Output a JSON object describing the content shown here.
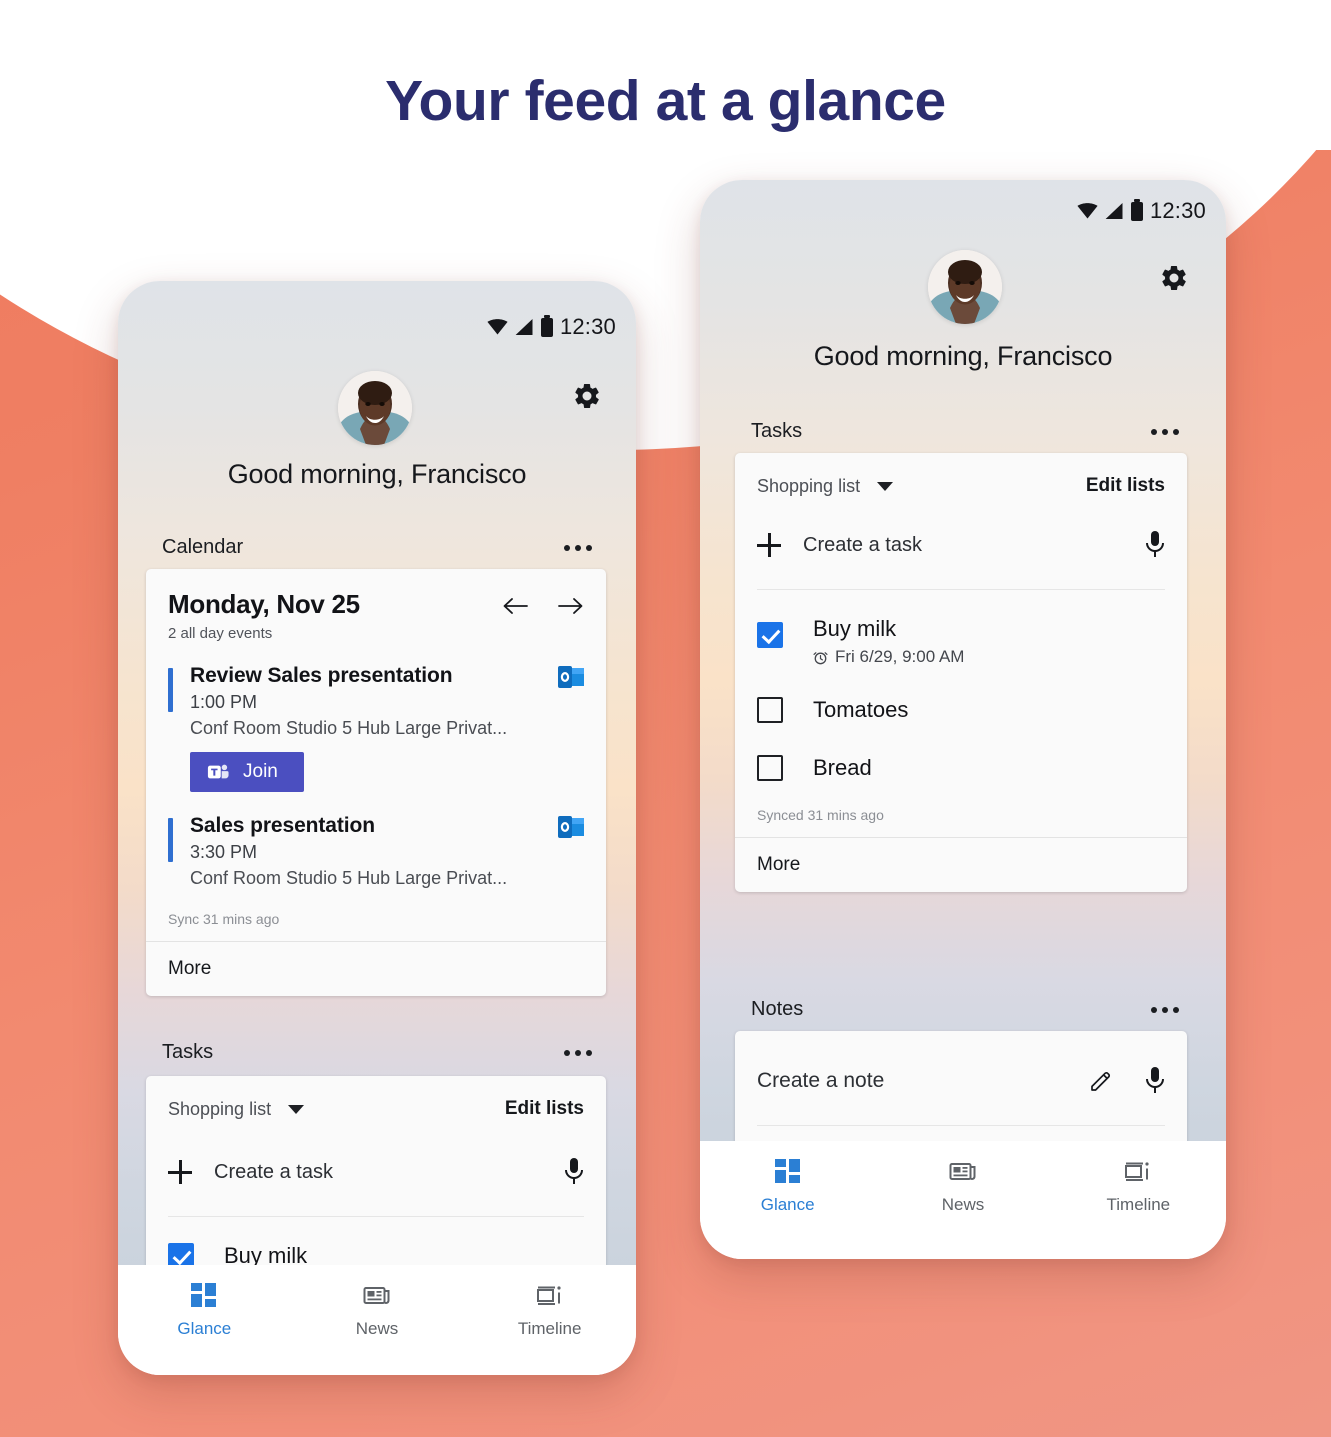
{
  "headline": "Your feed at a glance",
  "theme": {
    "background_orange": "#f0805f",
    "background_white": "#ffffff",
    "headline_color": "#2b2d6e",
    "accent_blue": "#1a73e8",
    "join_button_purple": "#4b4fc0",
    "event_bar_blue": "#2f6fd0"
  },
  "phone_left": {
    "status_bar": {
      "time": "12:30",
      "icons": [
        "wifi-icon",
        "signal-icon",
        "battery-icon"
      ]
    },
    "header": {
      "greeting": "Good morning, Francisco",
      "settings_icon": "gear-icon",
      "avatar": "user-avatar"
    },
    "calendar": {
      "section_title": "Calendar",
      "overflow": "more-options-icon",
      "date": "Monday, Nov 25",
      "subtitle": "2 all day events",
      "prev_icon": "arrow-left-icon",
      "next_icon": "arrow-right-icon",
      "events": [
        {
          "title": "Review Sales presentation",
          "time": "1:00 PM",
          "location": "Conf Room Studio 5 Hub Large Privat...",
          "source_icon": "outlook-icon",
          "join_label": "Join",
          "join_icon": "teams-icon"
        },
        {
          "title": "Sales presentation",
          "time": "3:30 PM",
          "location": "Conf Room Studio 5 Hub Large Privat...",
          "source_icon": "outlook-icon"
        }
      ],
      "sync": "Sync 31 mins ago",
      "more": "More"
    },
    "tasks": {
      "section_title": "Tasks",
      "overflow": "more-options-icon",
      "list_name": "Shopping list",
      "dropdown_icon": "chevron-down-icon",
      "edit_lists": "Edit lists",
      "create_label": "Create a task",
      "create_icon": "plus-icon",
      "mic_icon": "microphone-icon",
      "items": [
        {
          "label": "Buy milk",
          "done": true
        }
      ]
    },
    "nav": [
      {
        "label": "Glance",
        "icon": "glance-icon",
        "active": true
      },
      {
        "label": "News",
        "icon": "news-icon",
        "active": false
      },
      {
        "label": "Timeline",
        "icon": "timeline-icon",
        "active": false
      }
    ]
  },
  "phone_right": {
    "status_bar": {
      "time": "12:30",
      "icons": [
        "wifi-icon",
        "signal-icon",
        "battery-icon"
      ]
    },
    "header": {
      "greeting": "Good morning, Francisco",
      "settings_icon": "gear-icon",
      "avatar": "user-avatar"
    },
    "tasks": {
      "section_title": "Tasks",
      "overflow": "more-options-icon",
      "list_name": "Shopping list",
      "dropdown_icon": "chevron-down-icon",
      "edit_lists": "Edit lists",
      "create_label": "Create a task",
      "create_icon": "plus-icon",
      "mic_icon": "microphone-icon",
      "items": [
        {
          "label": "Buy milk",
          "due": "Fri 6/29, 9:00 AM",
          "due_icon": "alarm-icon",
          "done": true
        },
        {
          "label": "Tomatoes",
          "done": false
        },
        {
          "label": "Bread",
          "done": false
        }
      ],
      "sync": "Synced 31 mins ago",
      "more": "More"
    },
    "notes": {
      "section_title": "Notes",
      "overflow": "more-options-icon",
      "create_label": "Create a note",
      "pencil_icon": "pencil-icon",
      "mic_icon": "microphone-icon"
    },
    "nav": [
      {
        "label": "Glance",
        "icon": "glance-icon",
        "active": true
      },
      {
        "label": "News",
        "icon": "news-icon",
        "active": false
      },
      {
        "label": "Timeline",
        "icon": "timeline-icon",
        "active": false
      }
    ]
  }
}
